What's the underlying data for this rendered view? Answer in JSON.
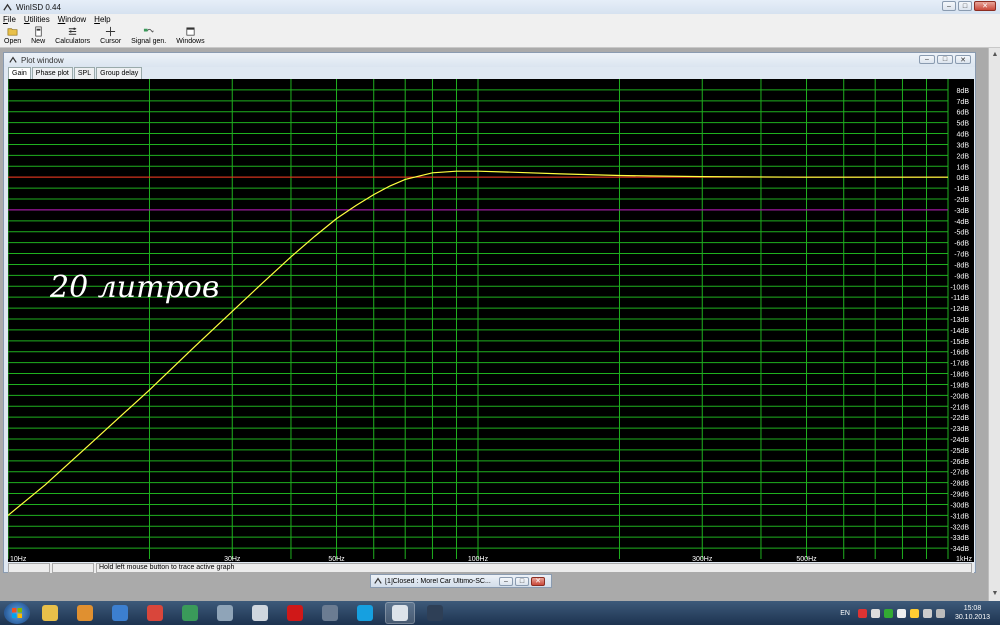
{
  "app": {
    "title": "WinISD 0.44"
  },
  "menu": {
    "items": [
      {
        "first": "F",
        "rest": "ile"
      },
      {
        "first": "U",
        "rest": "tilities"
      },
      {
        "first": "W",
        "rest": "indow"
      },
      {
        "first": "H",
        "rest": "elp"
      }
    ]
  },
  "toolbar": {
    "buttons": [
      {
        "label": "Open",
        "icon": "folder-open-icon"
      },
      {
        "label": "New",
        "icon": "new-document-icon"
      },
      {
        "label": "Calculators",
        "icon": "calculator-icon"
      },
      {
        "label": "Cursor",
        "icon": "crosshair-icon"
      },
      {
        "label": "Signal gen.",
        "icon": "signal-generator-icon"
      },
      {
        "label": "Windows",
        "icon": "windows-icon"
      }
    ]
  },
  "plot_window": {
    "title": "Plot window",
    "tabs": [
      "Gain",
      "Phase plot",
      "SPL",
      "Group delay"
    ],
    "active_tab": "Gain",
    "annotation": "20 литров",
    "status": "Hold left mouse button to trace active graph"
  },
  "chart_data": {
    "type": "line",
    "x_scale": "log",
    "xlim": [
      10,
      1000
    ],
    "ylim": [
      -35,
      9
    ],
    "x_tick_labels": [
      {
        "value": 10,
        "label": "10Hz"
      },
      {
        "value": 30,
        "label": "30Hz"
      },
      {
        "value": 50,
        "label": "50Hz"
      },
      {
        "value": 100,
        "label": "100Hz"
      },
      {
        "value": 300,
        "label": "300Hz"
      },
      {
        "value": 500,
        "label": "500Hz"
      },
      {
        "value": 1000,
        "label": "1kHz"
      }
    ],
    "x_grid": [
      10,
      20,
      30,
      40,
      50,
      60,
      70,
      80,
      90,
      100,
      200,
      300,
      400,
      500,
      600,
      700,
      800,
      900,
      1000
    ],
    "y_ticks": [
      8,
      7,
      6,
      5,
      4,
      3,
      2,
      1,
      0,
      -1,
      -2,
      -3,
      -4,
      -5,
      -6,
      -7,
      -8,
      -9,
      -10,
      -11,
      -12,
      -13,
      -14,
      -15,
      -16,
      -17,
      -18,
      -19,
      -20,
      -21,
      -22,
      -23,
      -24,
      -25,
      -26,
      -27,
      -28,
      -29,
      -30,
      -31,
      -32,
      -33,
      -34
    ],
    "y_unit": "dB",
    "reference_lines": [
      {
        "y": 0,
        "color": "#ff2020"
      },
      {
        "y": -3,
        "color": "#c000c0"
      }
    ],
    "series": [
      {
        "color": "#ffff40",
        "x": [
          10,
          12,
          15,
          20,
          25,
          30,
          35,
          40,
          45,
          50,
          55,
          60,
          65,
          70,
          80,
          90,
          100,
          120,
          150,
          200,
          300,
          500,
          700,
          1000
        ],
        "y": [
          -31,
          -28.2,
          -24.4,
          -19.5,
          -15.5,
          -12.3,
          -9.6,
          -7.3,
          -5.4,
          -3.8,
          -2.6,
          -1.6,
          -0.8,
          -0.2,
          0.4,
          0.55,
          0.55,
          0.45,
          0.3,
          0.15,
          0.05,
          0,
          0,
          0
        ]
      }
    ]
  },
  "minimized_window": {
    "title": "[1]Closed : Morel Car Ultimo-SC..."
  },
  "taskbar": {
    "lang": "EN",
    "time": "15:08",
    "date": "30.10.2013",
    "apps": [
      {
        "name": "explorer",
        "color": "#e8c04a"
      },
      {
        "name": "tool",
        "color": "#e09030"
      },
      {
        "name": "app-blue",
        "color": "#3c7fd0"
      },
      {
        "name": "chrome",
        "color": "#d9463b"
      },
      {
        "name": "app-green",
        "color": "#3a9a5a"
      },
      {
        "name": "app-gray",
        "color": "#8fa4b8"
      },
      {
        "name": "app-fox",
        "color": "#cfd6de"
      },
      {
        "name": "opera",
        "color": "#d01818"
      },
      {
        "name": "app-house",
        "color": "#6b7c92"
      },
      {
        "name": "skype",
        "color": "#16a0e0"
      },
      {
        "name": "winisd",
        "color": "#dde3ea"
      },
      {
        "name": "app-info",
        "color": "#2e3f56"
      }
    ]
  }
}
